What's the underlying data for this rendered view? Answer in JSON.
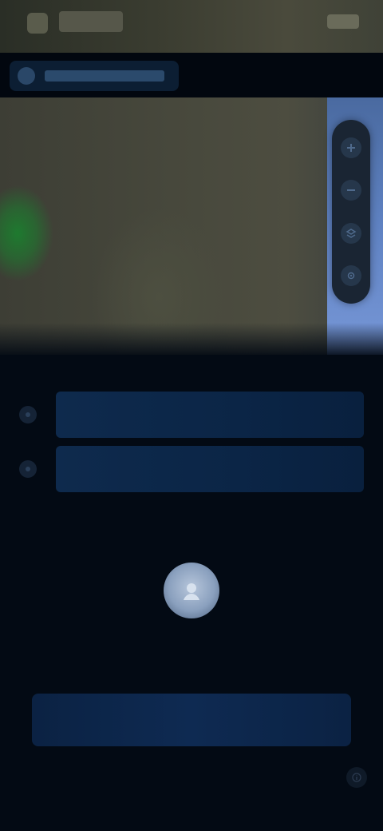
{
  "header": {
    "title": "",
    "status": ""
  },
  "titlebar": {
    "label": ""
  },
  "map": {
    "controls": [
      {
        "name": "zoom-in-icon"
      },
      {
        "name": "zoom-out-icon"
      },
      {
        "name": "layers-icon"
      },
      {
        "name": "locate-icon"
      }
    ]
  },
  "form": {
    "field_1": "",
    "field_2": ""
  },
  "section": {
    "label": ""
  },
  "empty_state": {
    "message": ""
  },
  "primary_button": {
    "label": ""
  },
  "footer": {
    "text": ""
  },
  "colors": {
    "background": "#030a14",
    "accent": "#0e2a4d",
    "water": "#5f82c2",
    "vegetation": "#1e7a2f"
  }
}
